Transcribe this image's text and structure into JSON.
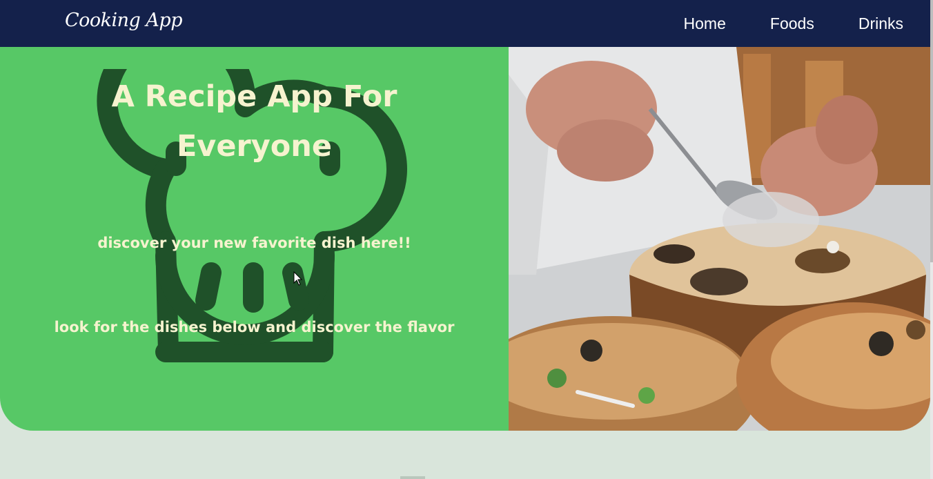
{
  "app": {
    "logo": "Cooking App"
  },
  "nav": {
    "items": [
      {
        "label": "Home"
      },
      {
        "label": "Foods"
      },
      {
        "label": "Drinks"
      }
    ]
  },
  "hero": {
    "title_line1": "A Recipe App For",
    "title_line2": "Everyone",
    "subtitle1": "discover your new favorite dish here!!",
    "subtitle2": "look for the dishes below and discover the flavor",
    "background_icon": "chef-hat-icon",
    "image_description_icon": "chef-plating-photo"
  },
  "colors": {
    "navbar": "#14214b",
    "hero_green": "#57c866",
    "hat_dark": "#1f5129",
    "text_cream": "#f6f3cf",
    "page_bg": "#d9e5db"
  }
}
